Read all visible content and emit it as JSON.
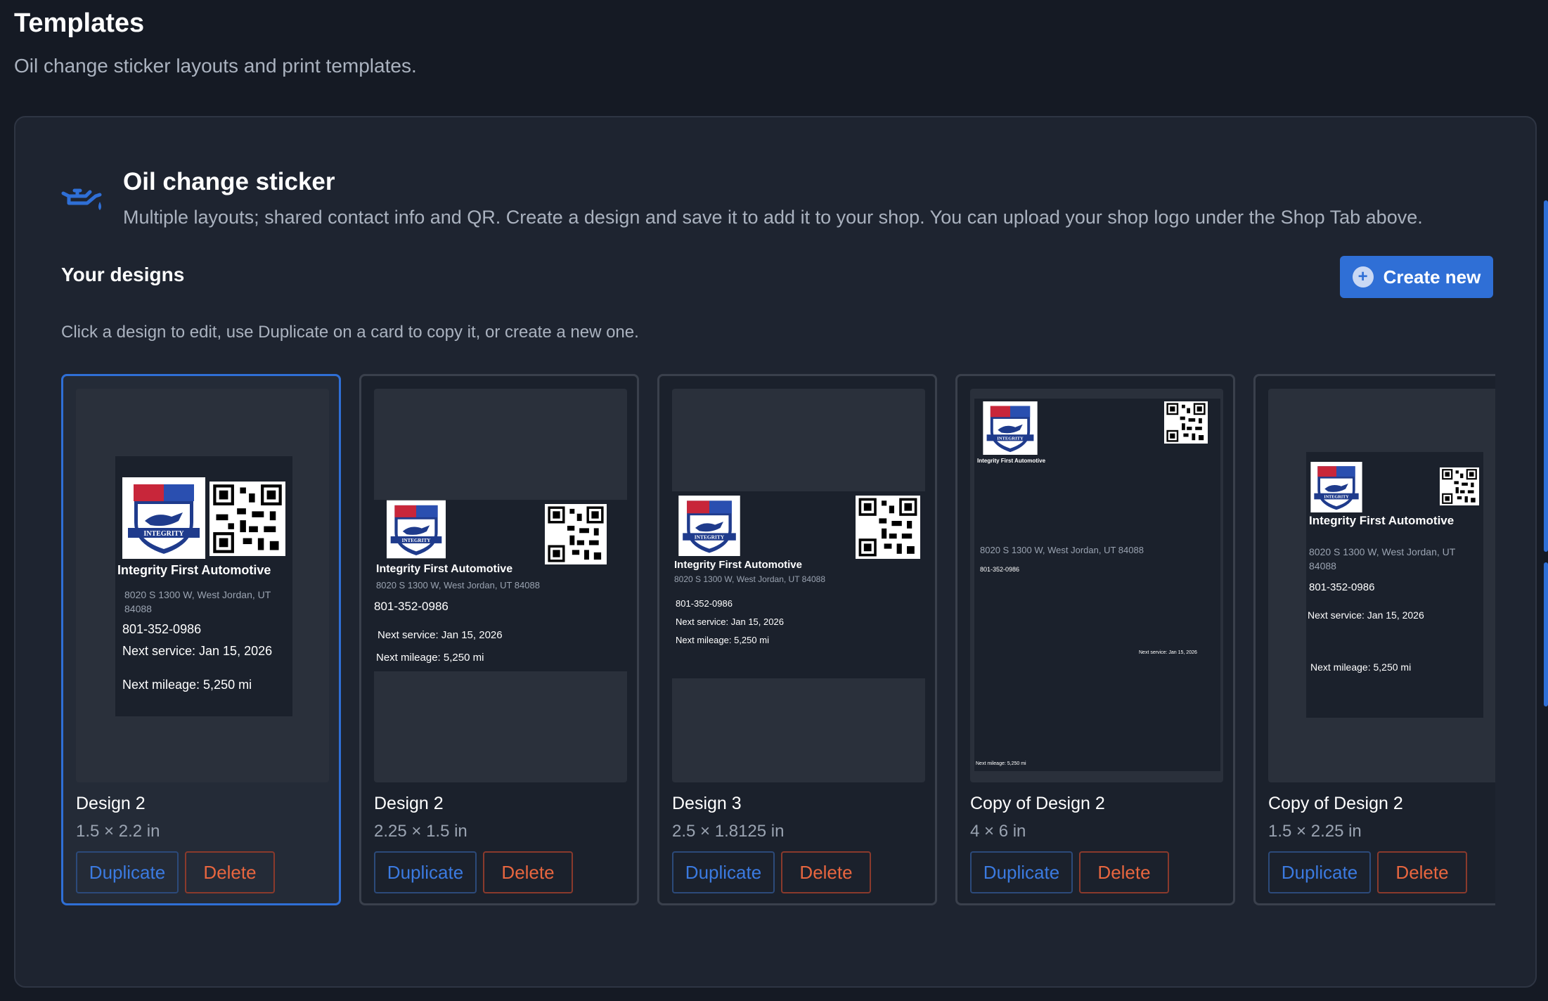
{
  "page": {
    "title": "Templates",
    "subtitle": "Oil change sticker layouts and print templates."
  },
  "section": {
    "icon": "oil-can-icon",
    "title": "Oil change sticker",
    "description": "Multiple layouts; shared contact info and QR. Create a design and save it to add it to your shop. You can upload your shop logo under the Shop Tab above."
  },
  "designs": {
    "heading": "Your designs",
    "hint": "Click a design to edit, use Duplicate on a card to copy it, or create a new one.",
    "create_label": "Create new"
  },
  "sticker": {
    "shop_name": "Integrity First Automotive",
    "address": "8020 S 1300 W, West Jordan, UT 84088",
    "phone": "801-352-0986",
    "next_service": "Next service: Jan 15, 2026",
    "next_mileage": "Next mileage: 5,250 mi"
  },
  "cards": [
    {
      "name": "Design 2",
      "size": "1.5 × 2.2 in",
      "selected": true,
      "duplicate_label": "Duplicate",
      "delete_label": "Delete"
    },
    {
      "name": "Design 2",
      "size": "2.25 × 1.5 in",
      "selected": false,
      "duplicate_label": "Duplicate",
      "delete_label": "Delete"
    },
    {
      "name": "Design 3",
      "size": "2.5 × 1.8125 in",
      "selected": false,
      "duplicate_label": "Duplicate",
      "delete_label": "Delete"
    },
    {
      "name": "Copy of Design 2",
      "size": "4 × 6 in",
      "selected": false,
      "duplicate_label": "Duplicate",
      "delete_label": "Delete"
    },
    {
      "name": "Copy of Design 2",
      "size": "1.5 × 2.25 in",
      "selected": false,
      "duplicate_label": "Duplicate",
      "delete_label": "Delete"
    }
  ],
  "colors": {
    "accent": "#2f6fd6",
    "danger": "#e8663f",
    "background": "#151a24",
    "panel": "#1e2430"
  }
}
